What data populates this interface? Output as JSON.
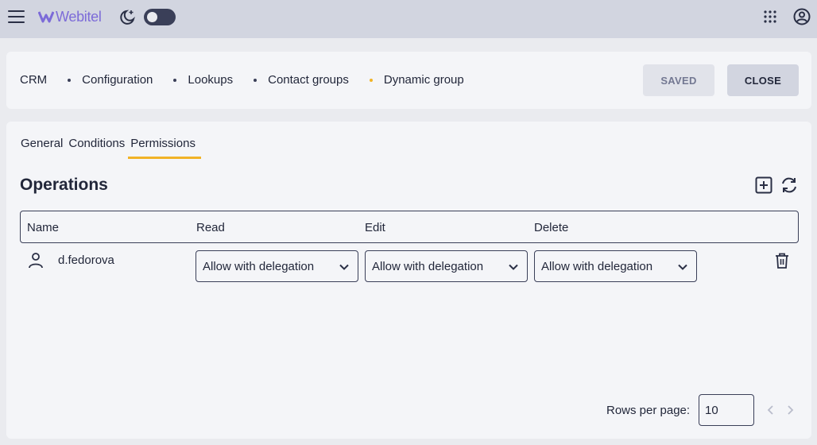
{
  "header": {
    "brand": "Webitel",
    "theme_toggle": "off",
    "icons": [
      "menu-icon",
      "webitel-logo",
      "moon-stars-icon",
      "apps-grid-icon",
      "account-circle-icon"
    ]
  },
  "breadcrumb": {
    "items": [
      "CRM",
      "Configuration",
      "Lookups",
      "Contact groups",
      "Dynamic group"
    ],
    "active_dot_color": "#f1b326"
  },
  "actions": {
    "saved_label": "SAVED",
    "close_label": "CLOSE"
  },
  "tabs": {
    "items": [
      "General",
      "Conditions",
      "Permissions"
    ],
    "active": "Permissions"
  },
  "section": {
    "title": "Operations"
  },
  "table": {
    "columns": [
      "Name",
      "Read",
      "Edit",
      "Delete"
    ],
    "rows": [
      {
        "name": "d.fedorova",
        "read": "Allow with delegation",
        "edit": "Allow with delegation",
        "delete": "Allow with delegation"
      }
    ]
  },
  "pagination": {
    "rows_per_page_label": "Rows per page:",
    "rows_per_page": "10"
  },
  "colors": {
    "accent": "#f1b326",
    "header_bg": "#d2d5e0",
    "text": "#22273a"
  }
}
